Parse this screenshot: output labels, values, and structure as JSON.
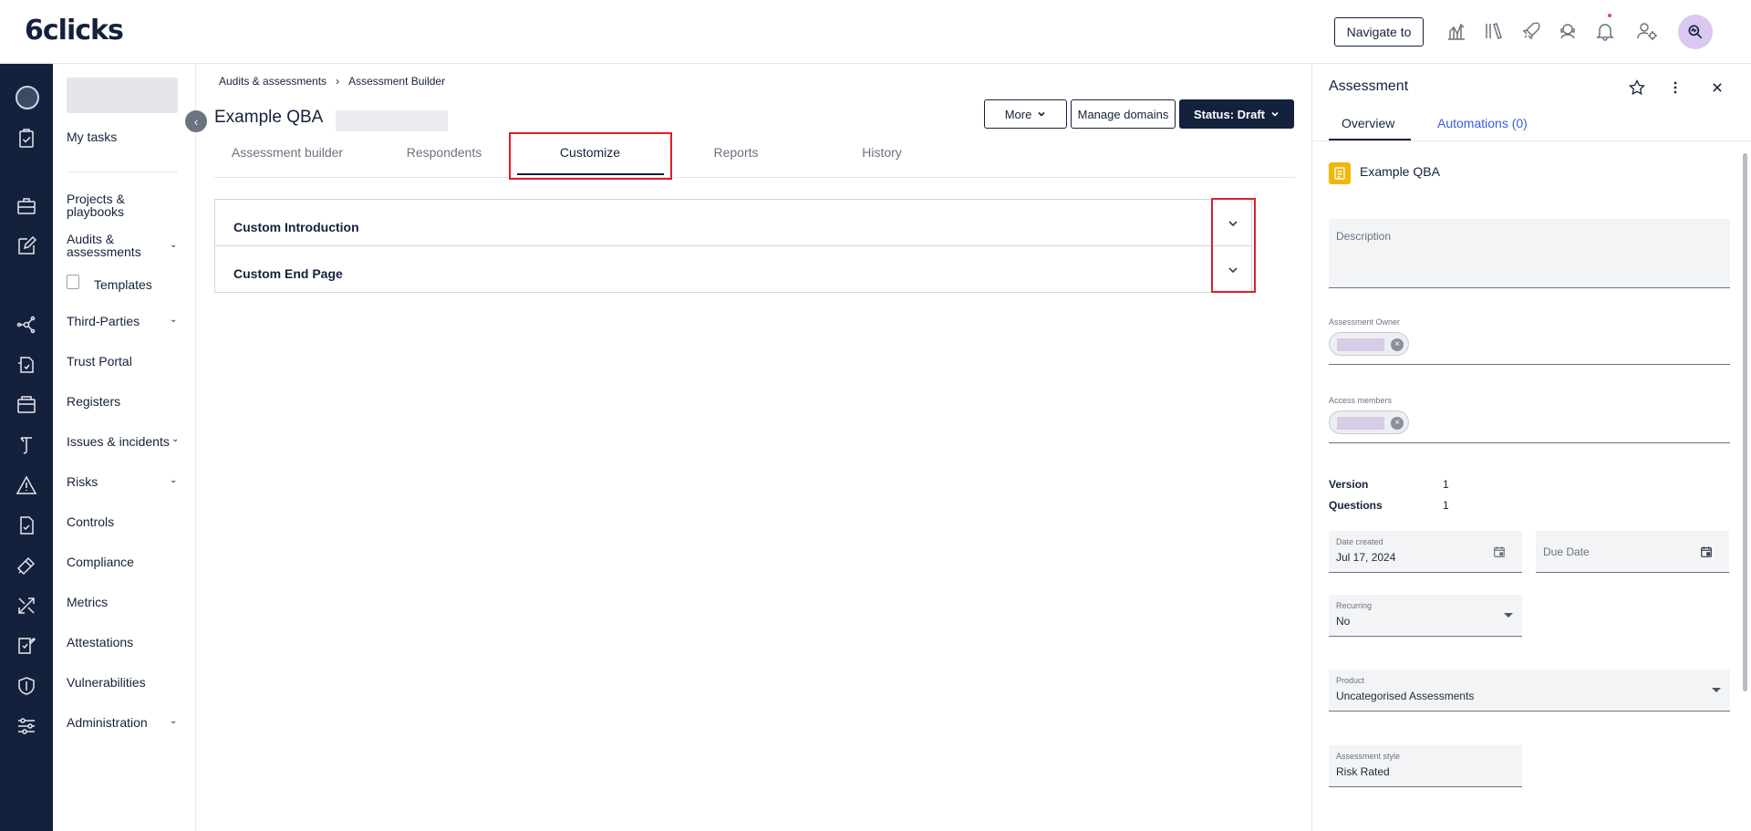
{
  "topbar": {
    "logo": "6clicks",
    "navigate_label": "Navigate to",
    "icons": [
      "analytics-icon",
      "library-icon",
      "rocket-icon",
      "support-icon",
      "bell-icon",
      "user-settings-icon"
    ]
  },
  "rail": {
    "icons": [
      "tasks-icon",
      "briefcase-icon",
      "edit-icon",
      "network-icon",
      "trust-icon",
      "registers-icon",
      "issues-icon",
      "risk-icon",
      "controls-icon",
      "compliance-icon",
      "metrics-icon",
      "attestations-icon",
      "shield-icon",
      "admin-icon"
    ]
  },
  "sidebar": {
    "my_tasks": "My tasks",
    "projects": "Projects & playbooks",
    "audits": "Audits & assessments",
    "templates": "Templates",
    "third_parties": "Third-Parties",
    "trust_portal": "Trust Portal",
    "registers": "Registers",
    "issues": "Issues & incidents",
    "risks": "Risks",
    "controls": "Controls",
    "compliance": "Compliance",
    "metrics": "Metrics",
    "attestations": "Attestations",
    "vulnerabilities": "Vulnerabilities",
    "administration": "Administration"
  },
  "main": {
    "breadcrumb": {
      "parent": "Audits & assessments",
      "separator": "›",
      "current": "Assessment Builder"
    },
    "title": "Example QBA",
    "buttons": {
      "more": "More",
      "manage_domains": "Manage domains",
      "status": "Status: Draft"
    },
    "tabs": [
      {
        "label": "Assessment builder"
      },
      {
        "label": "Respondents"
      },
      {
        "label": "Customize"
      },
      {
        "label": "Reports"
      },
      {
        "label": "History"
      }
    ],
    "accordions": [
      {
        "title": "Custom Introduction"
      },
      {
        "title": "Custom End Page"
      }
    ]
  },
  "panel": {
    "title": "Assessment",
    "tabs": {
      "overview": "Overview",
      "automations": "Automations (0)"
    },
    "name": "Example QBA",
    "description_label": "Description",
    "owner_label": "Assessment Owner",
    "members_label": "Access members",
    "version_label": "Version",
    "version_value": "1",
    "questions_label": "Questions",
    "questions_value": "1",
    "date_created_label": "Date created",
    "date_created_value": "Jul 17, 2024",
    "due_date_label": "Due Date",
    "recurring_label": "Recurring",
    "recurring_value": "No",
    "product_label": "Product",
    "product_value": "Uncategorised Assessments",
    "style_label": "Assessment style",
    "style_value": "Risk Rated"
  },
  "colors": {
    "navy": "#14213d",
    "highlight": "#e11d2a",
    "accent_yellow": "#f2b705"
  }
}
